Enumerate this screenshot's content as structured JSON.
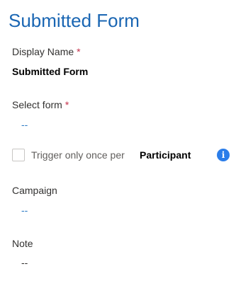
{
  "form": {
    "title": "Submitted Form",
    "display_name": {
      "label": "Display Name",
      "required_mark": "*",
      "value": "Submitted Form"
    },
    "select_form": {
      "label": "Select form",
      "required_mark": "*",
      "value": "--"
    },
    "trigger_once": {
      "checked": false,
      "label": "Trigger only once per",
      "entity": "Participant",
      "info_icon": "i"
    },
    "campaign": {
      "label": "Campaign",
      "value": "--"
    },
    "note": {
      "label": "Note",
      "value": "--"
    }
  },
  "colors": {
    "title": "#1a66b3",
    "required": "#c4314b",
    "link_placeholder": "#2f7cc5",
    "info_icon": "#2b7de9"
  }
}
